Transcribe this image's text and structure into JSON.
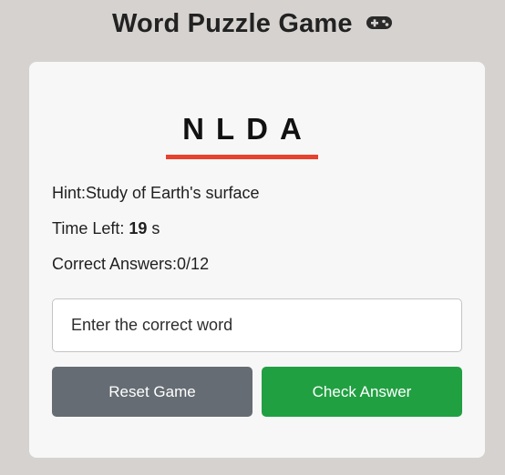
{
  "header": {
    "title": "Word Puzzle Game",
    "icon": "game-controller-icon"
  },
  "puzzle": {
    "scrambled_word": "NLDA",
    "underline_color": "#e8412d"
  },
  "info": {
    "hint_label": "Hint:",
    "hint_text": "Study of Earth's surface",
    "time_label": "Time Left: ",
    "time_value": "19",
    "time_unit": " s",
    "correct_label": "Correct Answers:",
    "correct_value": "0/12"
  },
  "input": {
    "placeholder": "Enter the correct word",
    "value": ""
  },
  "buttons": {
    "reset_label": "Reset Game",
    "reset_color": "#656c73",
    "check_label": "Check Answer",
    "check_color": "#21a042"
  }
}
